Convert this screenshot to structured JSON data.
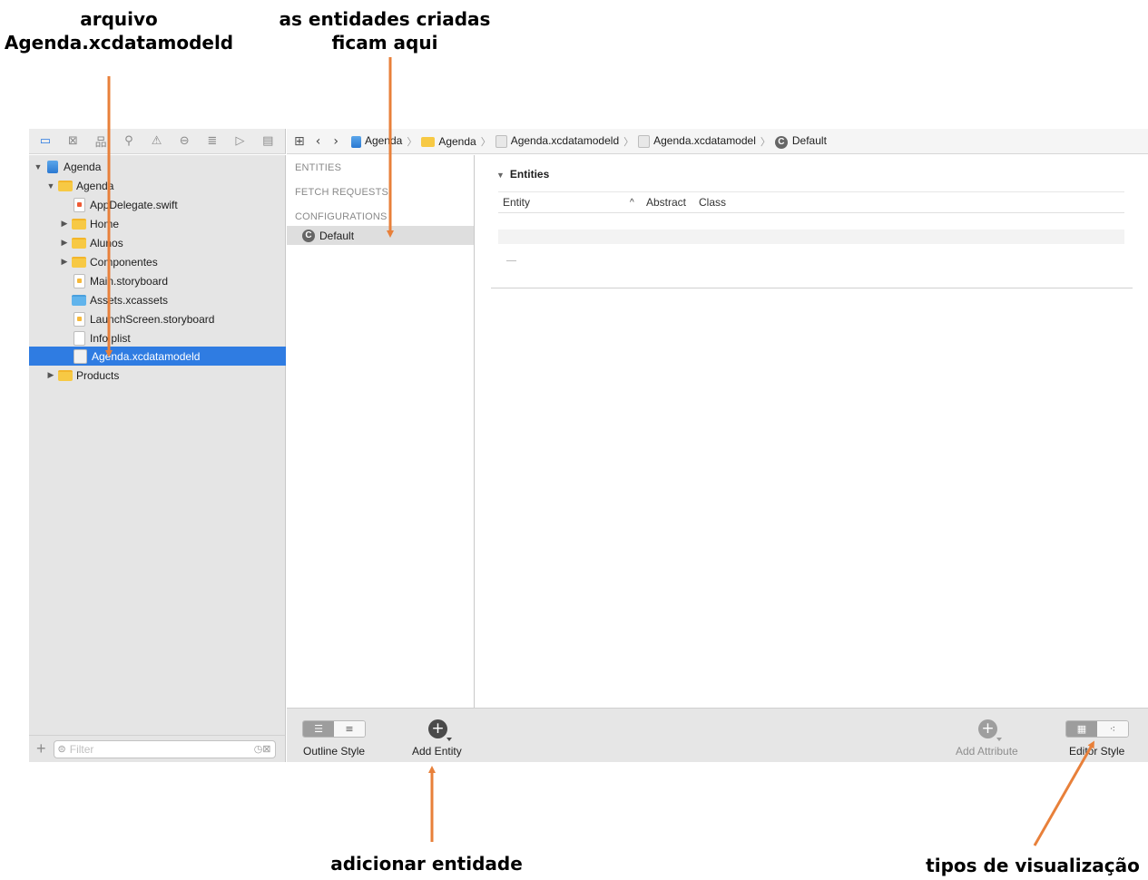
{
  "annotations": {
    "file": [
      "arquivo",
      "Agenda.xcdatamodeld"
    ],
    "entities": [
      "as entidades criadas",
      "ficam aqui"
    ],
    "add_entity": "adicionar entidade",
    "view_types": "tipos de visualização"
  },
  "navigator": {
    "tree": [
      {
        "label": "Agenda",
        "icon": "project-icon",
        "disclosure": "▼"
      },
      {
        "label": "Agenda",
        "icon": "folder-icon",
        "disclosure": "▼"
      },
      {
        "label": "AppDelegate.swift",
        "icon": "swift-file-icon",
        "disclosure": ""
      },
      {
        "label": "Home",
        "icon": "folder-icon",
        "disclosure": "▶"
      },
      {
        "label": "Alunos",
        "icon": "folder-icon",
        "disclosure": "▶"
      },
      {
        "label": "Componentes",
        "icon": "folder-icon",
        "disclosure": "▶"
      },
      {
        "label": "Main.storyboard",
        "icon": "storyboard-icon",
        "disclosure": ""
      },
      {
        "label": "Assets.xcassets",
        "icon": "assets-icon",
        "disclosure": ""
      },
      {
        "label": "LaunchScreen.storyboard",
        "icon": "storyboard-icon",
        "disclosure": ""
      },
      {
        "label": "Info.plist",
        "icon": "plist-icon",
        "disclosure": ""
      },
      {
        "label": "Agenda.xcdatamodeld",
        "icon": "data-model-icon",
        "disclosure": "",
        "selected": true
      },
      {
        "label": "Products",
        "icon": "folder-icon",
        "disclosure": "▶"
      }
    ],
    "filter_placeholder": "Filter",
    "add_button": "+"
  },
  "jump_bar": {
    "items": [
      "Agenda",
      "Agenda",
      "Agenda.xcdatamodeld",
      "Agenda.xcdatamodel",
      "Default"
    ]
  },
  "entity_panel": {
    "entities": "ENTITIES",
    "fetch_requests": "FETCH REQUESTS",
    "configurations": "CONFIGURATIONS",
    "default": "Default",
    "c_badge": "C"
  },
  "editor": {
    "section_title": "Entities",
    "columns": [
      "Entity",
      "^",
      "Abstract",
      "Class"
    ]
  },
  "toolbar": {
    "outline_style": "Outline Style",
    "add_entity": "Add Entity",
    "add_attribute": "Add Attribute",
    "editor_style": "Editor Style"
  },
  "colors": {
    "accent": "#2f7ce2",
    "arrow": "#e8803a"
  }
}
